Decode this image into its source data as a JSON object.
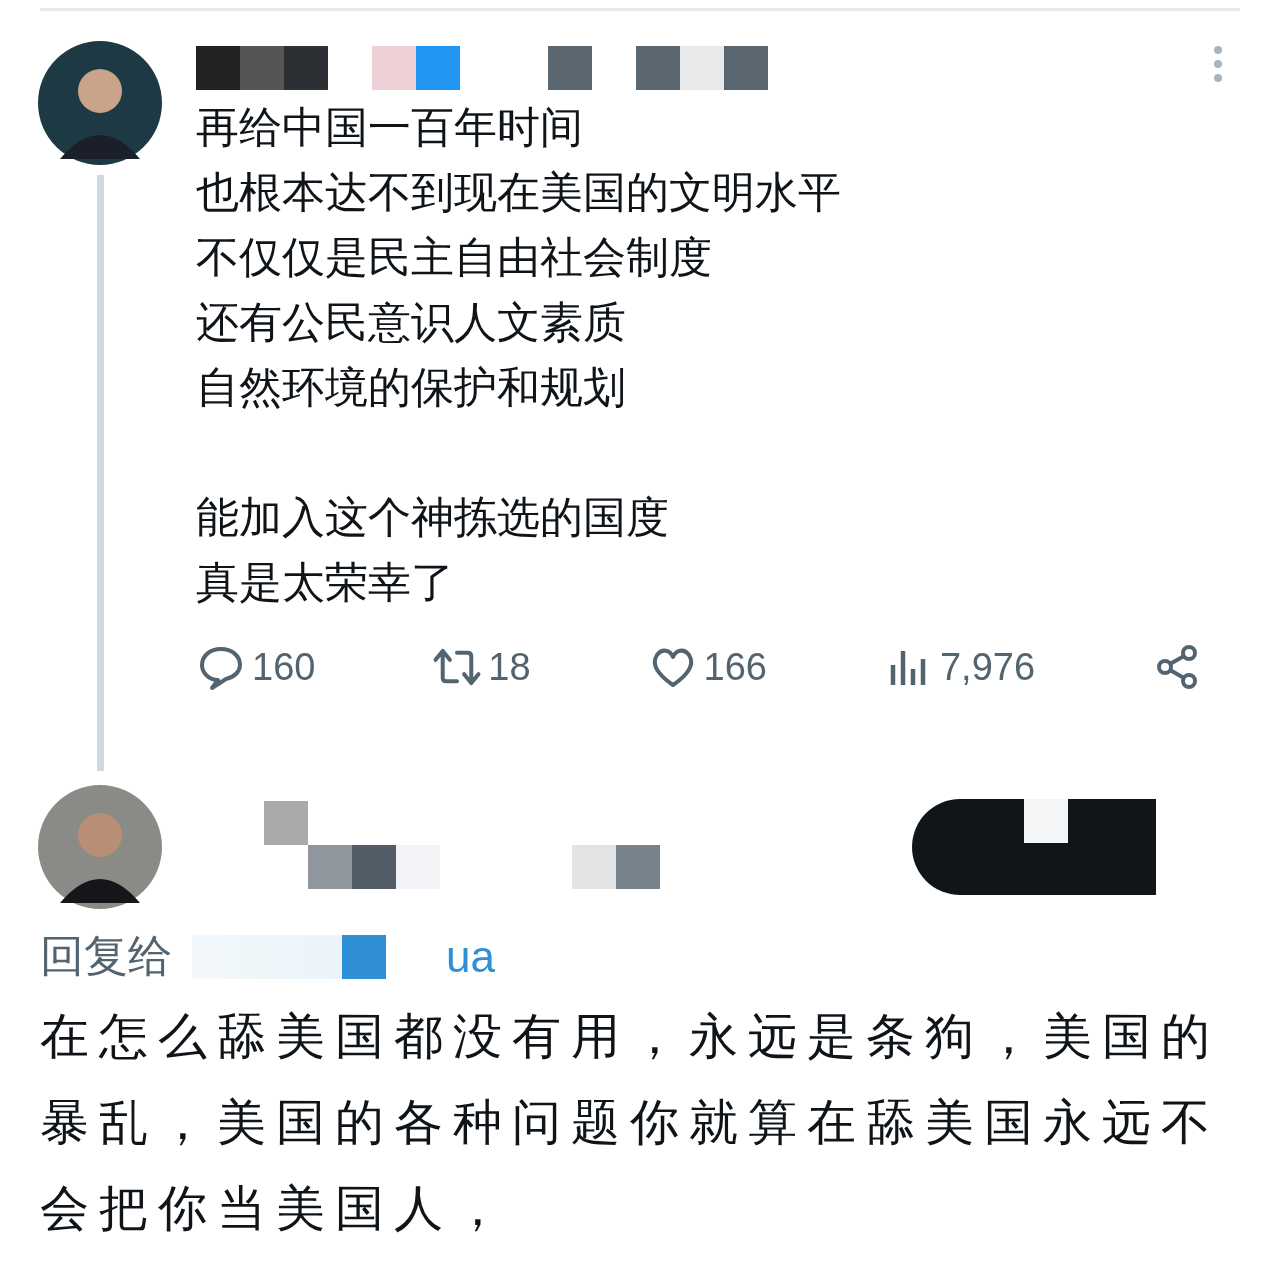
{
  "tweet": {
    "paragraphs": [
      [
        "再给中国一百年时间",
        "也根本达不到现在美国的文明水平",
        "不仅仅是民主自由社会制度",
        "还有公民意识人文素质",
        "自然环境的保护和规划"
      ],
      [
        "能加入这个神拣选的国度",
        "真是太荣幸了"
      ]
    ],
    "actions": [
      {
        "kind": "reply",
        "count": "160"
      },
      {
        "kind": "retweet",
        "count": "18"
      },
      {
        "kind": "like",
        "count": "166"
      },
      {
        "kind": "views",
        "count": "7,976"
      },
      {
        "kind": "share"
      }
    ]
  },
  "reply": {
    "reply_to_label": "回复给",
    "reply_to_handle": "ua",
    "text": "在怎么舔美国都没有用，永远是条狗，美国的暴乱，美国的各种问题你就算在舔美国永远不会把你当美国人，"
  }
}
